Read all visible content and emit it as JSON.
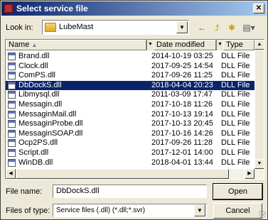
{
  "window": {
    "title": "Select service file",
    "close_glyph": "✕"
  },
  "lookin": {
    "label": "Look in:",
    "value": "LubeMast"
  },
  "toolbar": {
    "back": "←",
    "up": "⮥",
    "new_folder": "✱",
    "views": "▤▾"
  },
  "columns": {
    "name": "Name",
    "date": "Date modified",
    "type": "Type"
  },
  "files": [
    {
      "name": "Brand.dll",
      "date": "2014-10-19 03:25",
      "type": "DLL File"
    },
    {
      "name": "Clock.dll",
      "date": "2017-09-25 14:54",
      "type": "DLL File"
    },
    {
      "name": "ComPS.dll",
      "date": "2017-09-26 11:25",
      "type": "DLL File"
    },
    {
      "name": "DbDockS.dll",
      "date": "2018-04-04 20:23",
      "type": "DLL File",
      "selected": true
    },
    {
      "name": "Libmysql.dll",
      "date": "2011-03-09 17:47",
      "type": "DLL File"
    },
    {
      "name": "Messagin.dll",
      "date": "2017-10-18 11:26",
      "type": "DLL File"
    },
    {
      "name": "MessaginMail.dll",
      "date": "2017-10-13 19:14",
      "type": "DLL File"
    },
    {
      "name": "MessaginProbe.dll",
      "date": "2017-10-13 20:45",
      "type": "DLL File"
    },
    {
      "name": "MessaginSOAP.dll",
      "date": "2017-10-16 14:26",
      "type": "DLL File"
    },
    {
      "name": "Ocp2PS.dll",
      "date": "2017-09-26 11:28",
      "type": "DLL File"
    },
    {
      "name": "Script.dll",
      "date": "2017-12-01 14:00",
      "type": "DLL File"
    },
    {
      "name": "WinDB.dll",
      "date": "2018-04-01 13:44",
      "type": "DLL File"
    }
  ],
  "filename": {
    "label": "File name:",
    "value": "DbDockS.dll"
  },
  "filetype": {
    "label": "Files of type:",
    "value": "Service files (.dll) (*.dll;*.svr)"
  },
  "buttons": {
    "open": "Open",
    "cancel": "Cancel"
  },
  "colors": {
    "titlebar_start": "#0a246a",
    "titlebar_end": "#a6caf0",
    "selection": "#0a246a",
    "dialog_bg": "#ece9d8"
  }
}
